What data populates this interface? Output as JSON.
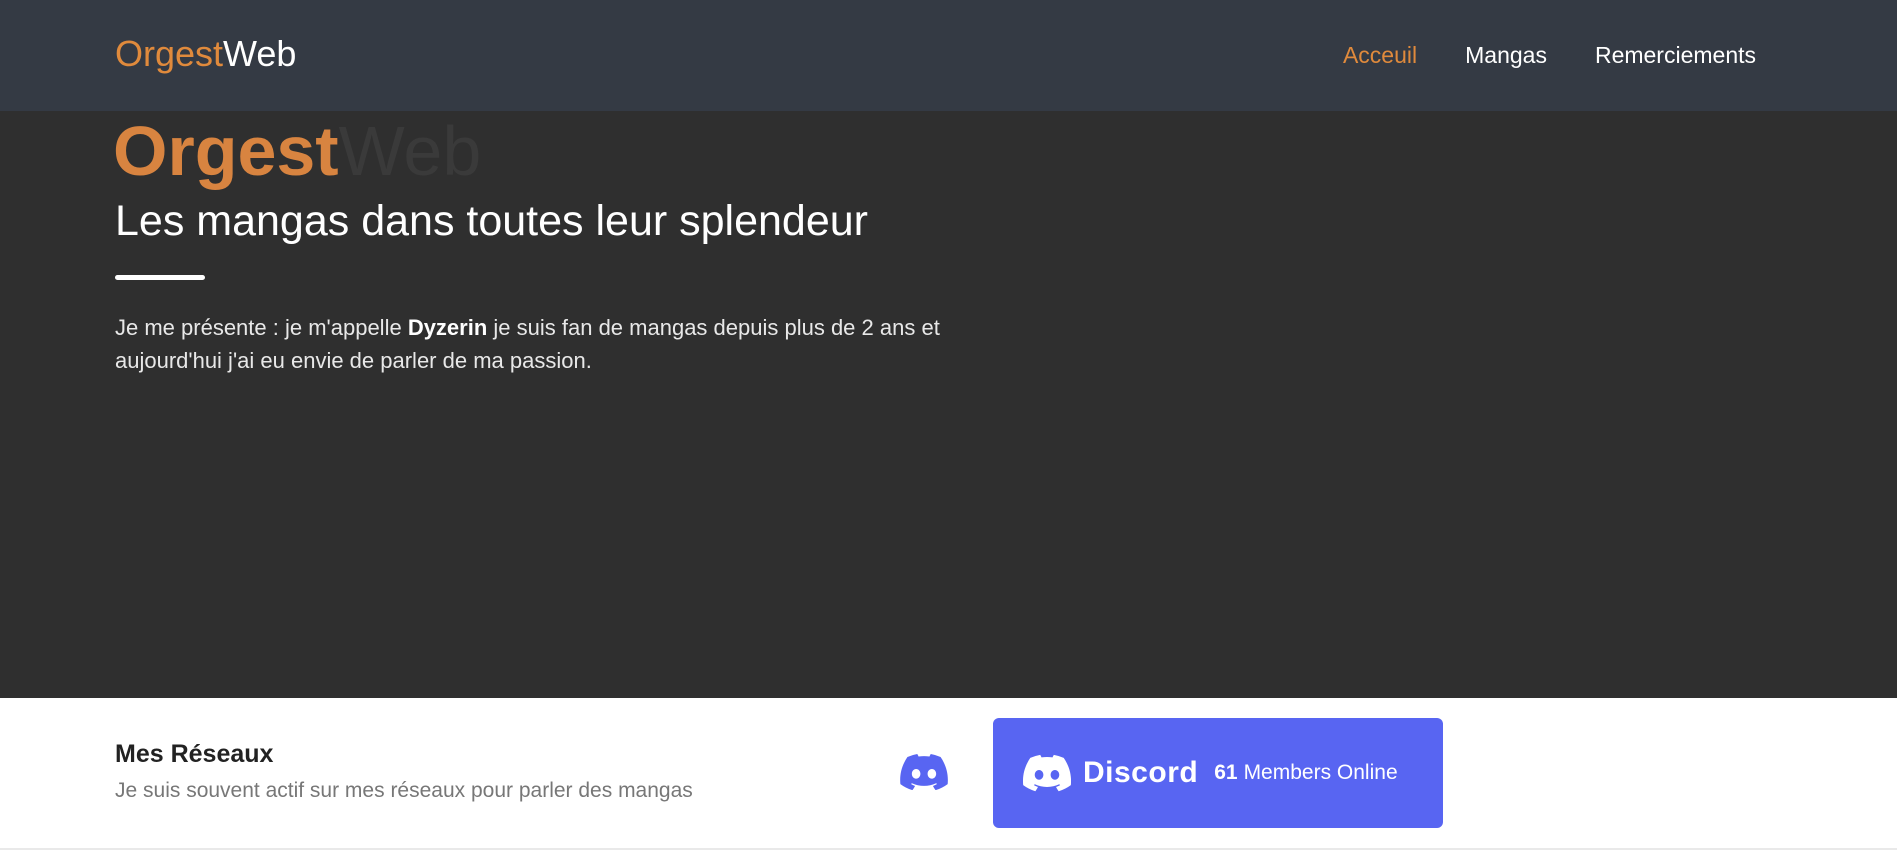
{
  "navbar": {
    "brand_accent": "Orgest",
    "brand_rest": "Web",
    "links": [
      {
        "label": "Acceuil",
        "active": true
      },
      {
        "label": "Mangas",
        "active": false
      },
      {
        "label": "Remerciements",
        "active": false
      }
    ]
  },
  "hero": {
    "title_accent": "Orgest",
    "title_rest": "Web",
    "subtitle": "Les mangas dans toutes leur splendeur",
    "intro_before": "Je me présente : je m'appelle ",
    "intro_name": "Dyzerin",
    "intro_after": " je suis fan de mangas depuis plus de 2 ans et aujourd'hui j'ai eu envie de parler de ma passion."
  },
  "socials": {
    "title": "Mes Réseaux",
    "subtitle": "Je suis souvent actif sur mes réseaux pour parler des mangas",
    "discord_icon": "discord-icon",
    "widget": {
      "brand": "Discord",
      "count": "61",
      "online_label": "Members Online"
    }
  },
  "colors": {
    "accent": "#e08a3c",
    "navbar_bg": "#343a44",
    "hero_bg": "#2f2f2f",
    "discord": "#5865f2"
  }
}
